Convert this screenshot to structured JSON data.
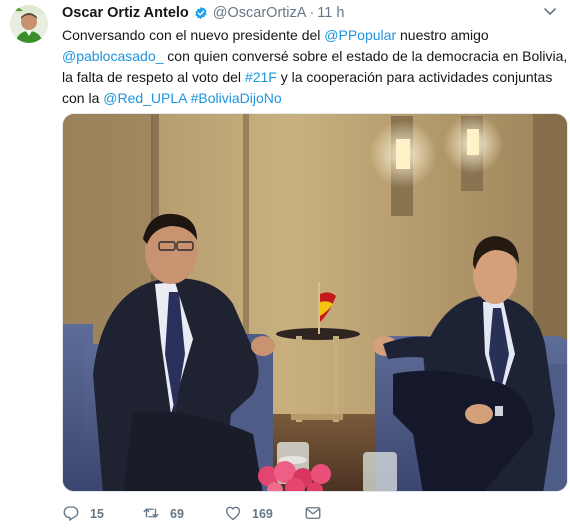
{
  "tweet": {
    "author": {
      "display_name": "Oscar Ortiz Antelo",
      "verified_icon": "verified-badge-icon",
      "handle": "@OscarOrtizA",
      "separator": "·",
      "time": "11 h"
    },
    "text": {
      "line1_a": "Conversando con el nuevo presidente del ",
      "mention_ppopular": "@PPopular",
      "line1_b": " nuestro amigo",
      "mention_pablocasado": "@pablocasado_",
      "line2_b": " con quien conversé sobre el estado de la democracia en Bolivia,",
      "line3_a": "la falta de respeto al voto del ",
      "hashtag_21f": "#21F",
      "line3_b": " y la cooperación para actividades conjuntas",
      "line4_a": "con la ",
      "mention_red_upla": "@Red_UPLA",
      "line4_b": " ",
      "hashtag_boliviadijono": "#BoliviaDijoNo"
    },
    "actions": {
      "reply_count": "15",
      "retweet_count": "69",
      "like_count": "169"
    },
    "colors": {
      "link": "#1b95e0",
      "secondary_text": "#657786",
      "verified": "#1da1f2"
    }
  }
}
